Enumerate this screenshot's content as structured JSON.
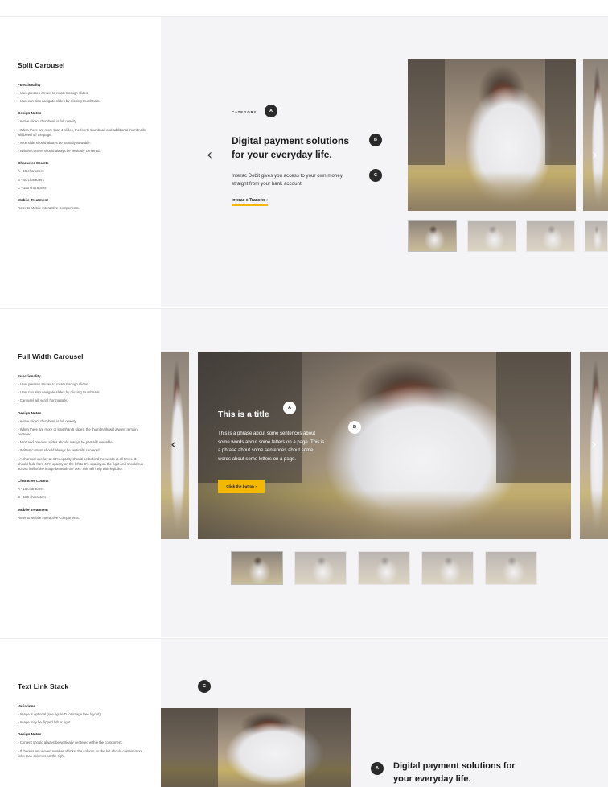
{
  "split": {
    "title": "Split Carousel",
    "functionality_heading": "Functionality",
    "functionality": [
      "• User presses arrows to rotate through slides.",
      "• User can also navigate slides by clicking thumbnails."
    ],
    "design_heading": "Design Notes",
    "design": [
      "• Active slide’s thumbnail is full opacity.",
      "• When there are more than 4 slides, the fourth thumbnail and additional thumbnails will bleed off the page.",
      "• Next slide should always be partially viewable.",
      "• Written content should always be vertically centered."
    ],
    "counts_heading": "Character Counts",
    "counts": [
      "A - 15 characters",
      "B - 40 characters",
      "C - 150 characters"
    ],
    "mobile_heading": "Mobile Treatment",
    "mobile": "Refer to Mobile Interactive Components.",
    "category": "CATEGORY",
    "badge_a": "A",
    "badge_b": "B",
    "badge_c": "C",
    "headline_line1": "Digital payment solutions",
    "headline_line2": "for your everyday life.",
    "body_line1": "Interac Debit gives you access to your own money,",
    "body_line2": "straight from your bank account.",
    "link": "Interac e-Transfer  ›",
    "prev_arrow": "‹",
    "next_arrow": "›"
  },
  "full": {
    "title": "Full Width Carousel",
    "functionality_heading": "Functionality",
    "functionality": [
      "• User presses arrows to rotate through slides.",
      "• User can also navigate slides by clicking thumbnails.",
      "• Carousel will scroll horizontally."
    ],
    "design_heading": "Design Notes",
    "design": [
      "• Active slide’s thumbnail is full opacity.",
      "• When there are more or less than 5 slides, the thumbnails will always remain centered.",
      "• Next and previous slides should always be partially viewable.",
      "• Written content should always be vertically centered.",
      "• A charcoal overlay at 40% opacity should be behind the words at all times. It should fade from 40% opacity on the left to 0% opacity on the right and should run across half of the image beneath the text. This will help with legibility."
    ],
    "counts_heading": "Character Counts",
    "counts": [
      "A - 15 characters",
      "B - 180 characters"
    ],
    "mobile_heading": "Mobile Treatment",
    "mobile": "Refer to Mobile Interactive Components.",
    "slide_title": "This is a title",
    "badge_a": "A",
    "badge_b": "B",
    "slide_body_1": "This is a phrase about some sentences about",
    "slide_body_2": "some words about some letters on a page. This is",
    "slide_body_3": "a phrase about some sentences about some",
    "slide_body_4": "words about some letters on a page.",
    "cta": "Click the button  ›",
    "prev_arrow": "‹",
    "next_arrow": "›"
  },
  "stack": {
    "title": "Text Link Stack",
    "variations_heading": "Variations",
    "variations": [
      "• Image is optional (see figure D for image free layout).",
      "• Image may be flipped left or right."
    ],
    "design_heading": "Design Notes",
    "design": [
      "• Content should always be vertically centered within the component.",
      "• If there is an uneven number of links, the column on the left should contain more links than columns on the right."
    ],
    "badge_c": "C",
    "badge_a": "A",
    "headline_line1": "Digital payment solutions for",
    "headline_line2": "your everyday life."
  }
}
